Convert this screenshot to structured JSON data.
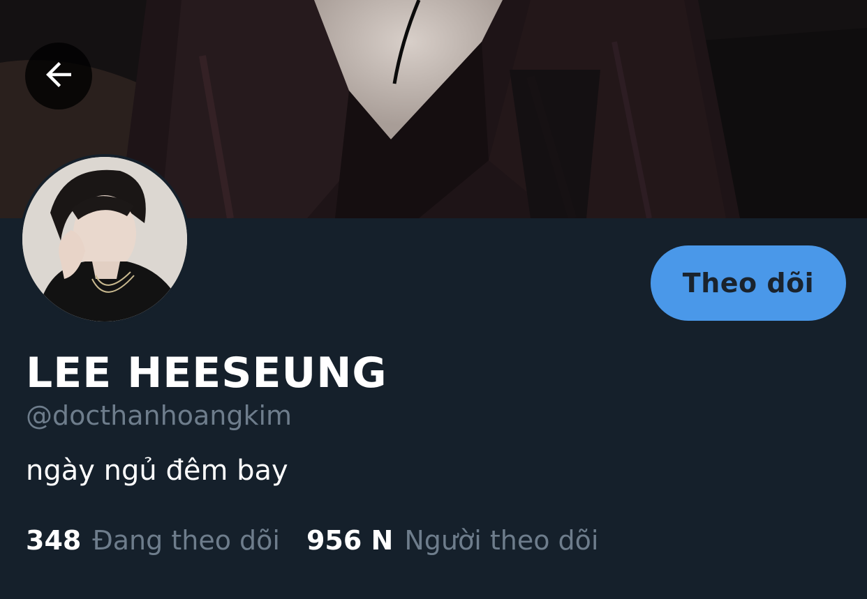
{
  "profile": {
    "display_name": "LEE HEESEUNG",
    "handle": "@docthanhoangkim",
    "bio": "ngày ngủ đêm bay",
    "follow_label": "Theo dõi",
    "following": {
      "count": "348",
      "label": "Đang theo dõi"
    },
    "followers": {
      "count": "956 N",
      "label": "Người theo dõi"
    }
  },
  "icons": {
    "back": "arrow-left-icon"
  },
  "colors": {
    "background": "#15202b",
    "accent": "#4a98e9",
    "text_primary": "#ffffff",
    "text_secondary": "#6e7d8c"
  }
}
